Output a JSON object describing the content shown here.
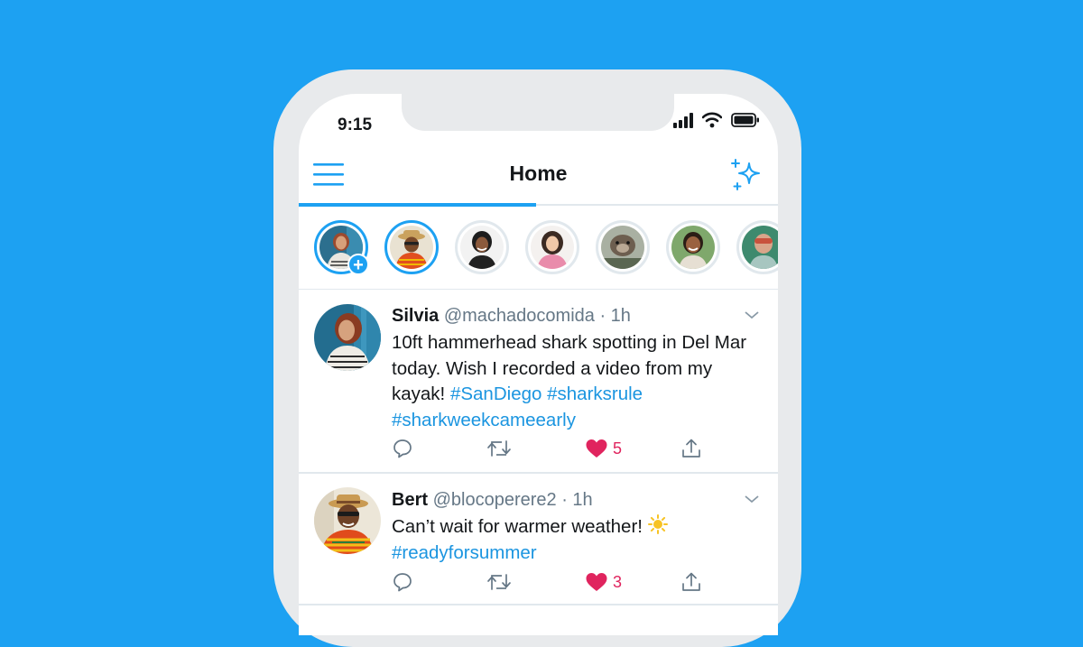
{
  "status_bar": {
    "time": "9:15"
  },
  "header": {
    "title": "Home"
  },
  "colors": {
    "accent": "#1da1f2",
    "like": "#e0245e",
    "hashtag": "#1b95e0",
    "text": "#14171a",
    "muted": "#657786"
  },
  "fleets": [
    {
      "name": "your-fleet",
      "ring": "blue",
      "add": "+"
    },
    {
      "name": "bert",
      "ring": "blue"
    },
    {
      "name": "fleet-3",
      "ring": "gray"
    },
    {
      "name": "fleet-4",
      "ring": "gray"
    },
    {
      "name": "fleet-5",
      "ring": "gray"
    },
    {
      "name": "fleet-6",
      "ring": "gray"
    },
    {
      "name": "fleet-7",
      "ring": "gray"
    }
  ],
  "tweets": [
    {
      "name": "Silvia",
      "handle": "@machadocomida",
      "time": "· 1h",
      "text": "10ft hammerhead shark spotting in Del Mar today. Wish I recorded a video from my kayak! ",
      "tags": [
        "#SanDiego",
        "#sharksrule",
        "#sharkweekcameearly"
      ],
      "likes": "5"
    },
    {
      "name": "Bert",
      "handle": "@blocoperere2",
      "time": "· 1h",
      "text": "Can’t wait for warmer weather! ",
      "tags": [
        "#readyforsummer"
      ],
      "likes": "3"
    }
  ],
  "icons": {
    "menu": "hamburger-icon",
    "sparkle": "sparkle-icon",
    "reply": "reply-icon",
    "retweet": "retweet-icon",
    "like": "heart-icon",
    "share": "share-icon",
    "chevron": "chevron-down-icon",
    "sun": "sun-emoji-icon"
  }
}
